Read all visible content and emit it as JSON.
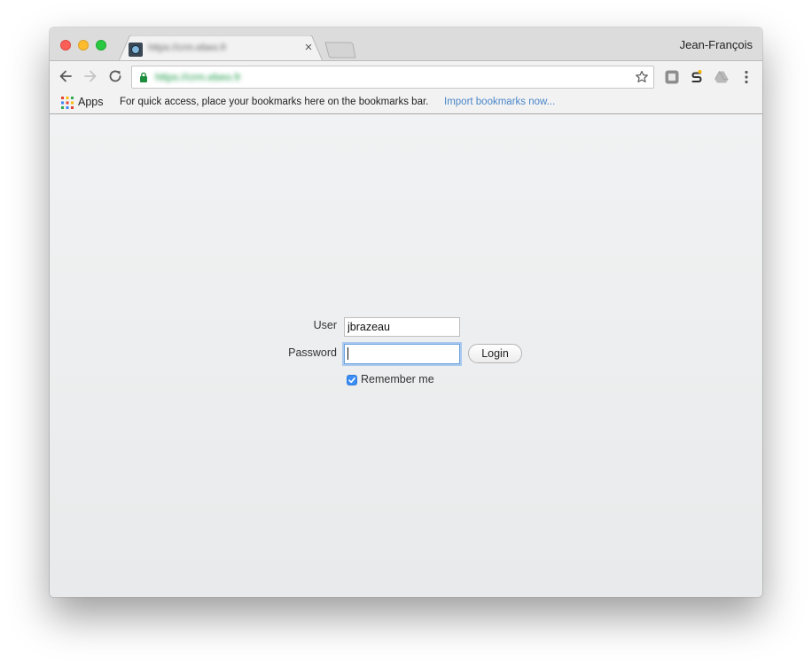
{
  "browser": {
    "tab": {
      "title": "https://crm.ebeo.fr",
      "close_glyph": "×"
    },
    "profile_name": "Jean-François",
    "address_bar": {
      "url": "https://crm.ebeo.fr"
    },
    "bookmarks_bar": {
      "apps_label": "Apps",
      "hint": "For quick access, place your bookmarks here on the bookmarks bar.",
      "import_link": "Import bookmarks now..."
    }
  },
  "login_form": {
    "user_label": "User",
    "user_value": "jbrazeau",
    "password_label": "Password",
    "password_value": "",
    "login_button": "Login",
    "remember_label": "Remember me",
    "remember_checked": true
  },
  "colors": {
    "accent": "#3b8ef5",
    "link": "#4a86c9",
    "secure_url": "#1e9c4a"
  }
}
